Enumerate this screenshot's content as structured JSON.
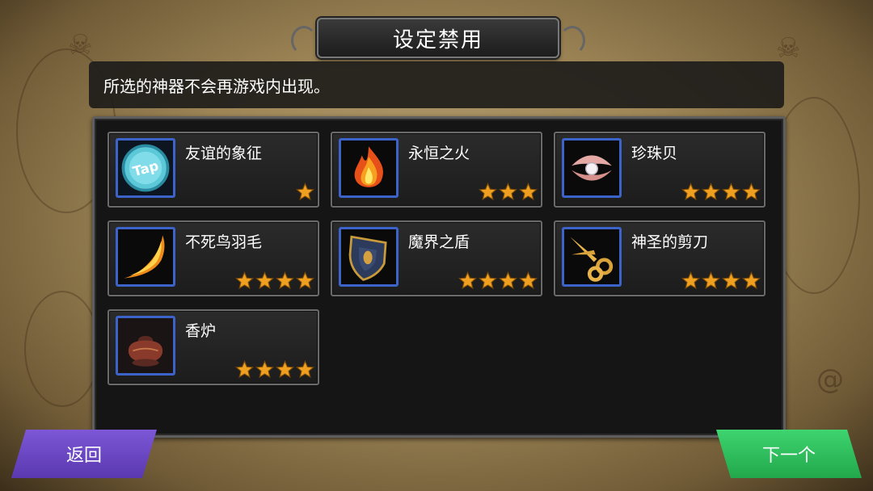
{
  "title": "设定禁用",
  "description": "所选的神器不会再游戏内出现。",
  "artifacts": [
    {
      "name": "友谊的象征",
      "stars": 1,
      "icon": "tap-coin-icon"
    },
    {
      "name": "永恒之火",
      "stars": 3,
      "icon": "flame-icon"
    },
    {
      "name": "珍珠贝",
      "stars": 4,
      "icon": "pearl-shell-icon"
    },
    {
      "name": "不死鸟羽毛",
      "stars": 4,
      "icon": "phoenix-feather-icon"
    },
    {
      "name": "魔界之盾",
      "stars": 4,
      "icon": "demon-shield-icon"
    },
    {
      "name": "神圣的剪刀",
      "stars": 4,
      "icon": "golden-scissors-icon"
    },
    {
      "name": "香炉",
      "stars": 4,
      "icon": "incense-burner-icon"
    }
  ],
  "buttons": {
    "back": "返回",
    "next": "下一个"
  },
  "colors": {
    "star": "#f0a020",
    "icon_border": "#3b63c9",
    "back": "#6a46c4",
    "next": "#2fbf5c"
  }
}
